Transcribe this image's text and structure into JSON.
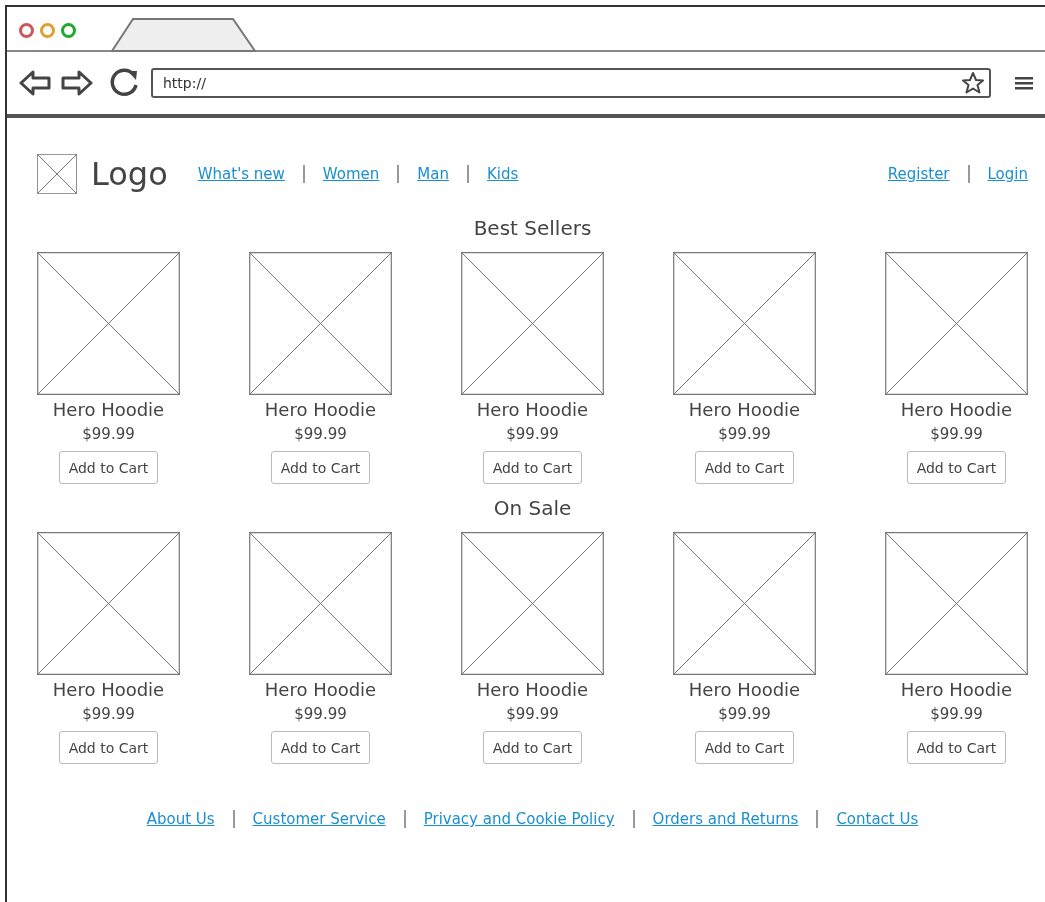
{
  "window_controls": [
    {
      "color": "#c9585d"
    },
    {
      "color": "#e0a030"
    },
    {
      "color": "#20a830"
    }
  ],
  "browser": {
    "url": "http://"
  },
  "header": {
    "logo": "Logo",
    "nav": [
      "What's new",
      "Women",
      "Man",
      "Kids"
    ],
    "account": [
      "Register",
      "Login"
    ]
  },
  "sections": [
    {
      "title": "Best Sellers",
      "products": [
        {
          "name": "Hero Hoodie",
          "price": "$99.99",
          "button": "Add to Cart"
        },
        {
          "name": "Hero Hoodie",
          "price": "$99.99",
          "button": "Add to Cart"
        },
        {
          "name": "Hero Hoodie",
          "price": "$99.99",
          "button": "Add to Cart"
        },
        {
          "name": "Hero Hoodie",
          "price": "$99.99",
          "button": "Add to Cart"
        },
        {
          "name": "Hero Hoodie",
          "price": "$99.99",
          "button": "Add to Cart"
        }
      ]
    },
    {
      "title": "On Sale",
      "products": [
        {
          "name": "Hero Hoodie",
          "price": "$99.99",
          "button": "Add to Cart"
        },
        {
          "name": "Hero Hoodie",
          "price": "$99.99",
          "button": "Add to Cart"
        },
        {
          "name": "Hero Hoodie",
          "price": "$99.99",
          "button": "Add to Cart"
        },
        {
          "name": "Hero Hoodie",
          "price": "$99.99",
          "button": "Add to Cart"
        },
        {
          "name": "Hero Hoodie",
          "price": "$99.99",
          "button": "Add to Cart"
        }
      ]
    }
  ],
  "footer": [
    "About Us",
    "Customer Service",
    "Privacy and Cookie Policy",
    "Orders and Returns",
    "Contact Us"
  ]
}
